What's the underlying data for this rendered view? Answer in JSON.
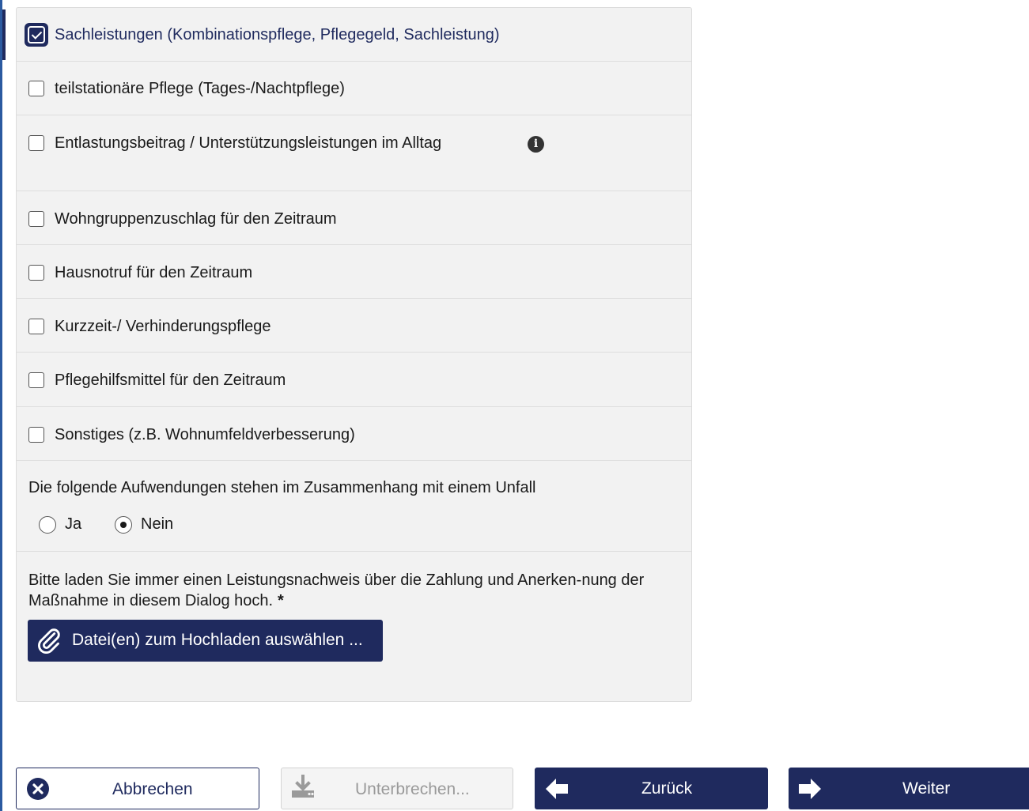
{
  "options": [
    {
      "label": "Sachleistungen (Kombinationspflege, Pflegegeld, Sachleistung)",
      "checked": true
    },
    {
      "label": "teilstationäre Pflege (Tages-/Nachtpflege)",
      "checked": false
    },
    {
      "label": "Entlastungsbeitrag / Unterstützungsleistungen im Alltag",
      "checked": false,
      "has_info": true
    },
    {
      "label": "Wohngruppenzuschlag für den Zeitraum",
      "checked": false
    },
    {
      "label": "Hausnotruf für den Zeitraum",
      "checked": false
    },
    {
      "label": "Kurzzeit-/ Verhinderungspflege",
      "checked": false
    },
    {
      "label": "Pflegehilfsmittel für den Zeitraum",
      "checked": false
    },
    {
      "label": "Sonstiges (z.B. Wohnumfeldverbesserung)",
      "checked": false
    }
  ],
  "accident": {
    "question": "Die folgende Aufwendungen stehen im Zusammenhang mit einem Unfall",
    "yes_label": "Ja",
    "no_label": "Nein",
    "selected": "Nein"
  },
  "upload": {
    "instruction": "Bitte laden Sie immer einen Leistungsnachweis über die Zahlung und Anerken-nung der Maßnahme in diesem Dialog hoch.",
    "required_mark": "*",
    "button_label": "Datei(en) zum Hochladen auswählen ..."
  },
  "footer": {
    "cancel_label": "Abbrechen",
    "pause_label": "Unterbrechen...",
    "back_label": "Zurück",
    "next_label": "Weiter"
  },
  "colors": {
    "primary": "#1f2a5e",
    "panel_bg": "#f2f2f2",
    "disabled_text": "#9a9a9a"
  },
  "icons": {
    "info": "info-icon",
    "upload": "paperclip-icon",
    "cancel": "close-circle-icon",
    "pause": "download-icon",
    "back": "arrow-left-icon",
    "next": "arrow-right-icon"
  }
}
